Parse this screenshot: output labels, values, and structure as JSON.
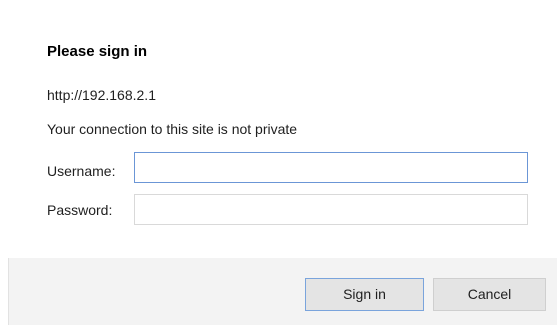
{
  "dialog": {
    "title": "Please sign in",
    "origin": "http://192.168.2.1",
    "warning": "Your connection to this site is not private"
  },
  "form": {
    "username_label": "Username:",
    "username_value": "",
    "password_label": "Password:",
    "password_value": ""
  },
  "buttons": {
    "sign_in": "Sign in",
    "cancel": "Cancel"
  }
}
